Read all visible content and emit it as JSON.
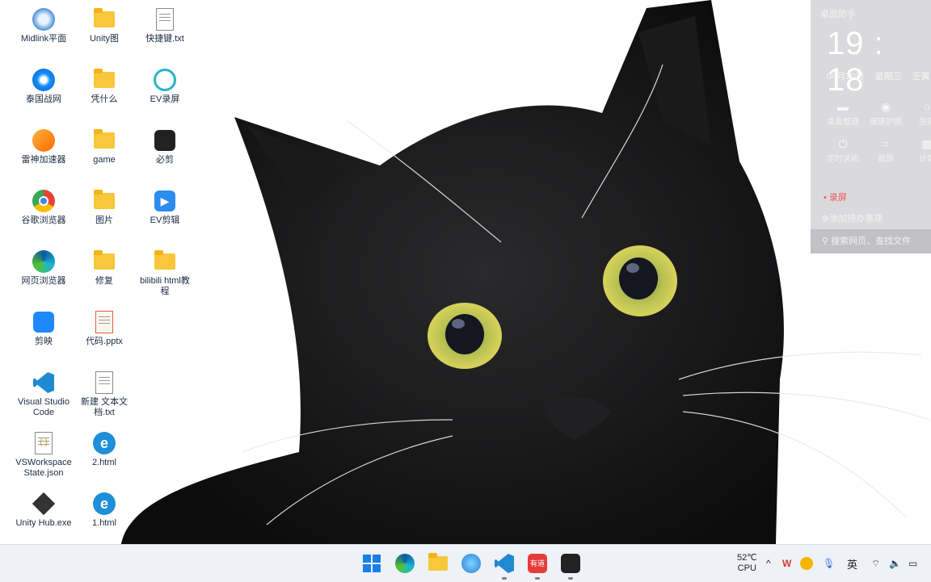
{
  "desktop_icons": [
    {
      "label": "Midlink平面",
      "icon": "midlink-app-icon"
    },
    {
      "label": "Unity图",
      "icon": "folder-icon"
    },
    {
      "label": "快捷键.txt",
      "icon": "text-file-icon"
    },
    {
      "label": "泰国战网",
      "icon": "battle-net-icon"
    },
    {
      "label": "凭什么",
      "icon": "folder-icon"
    },
    {
      "label": "EV录屏",
      "icon": "ev-recorder-icon"
    },
    {
      "label": "雷神加速器",
      "icon": "leishen-accelerator-icon"
    },
    {
      "label": "game",
      "icon": "folder-icon"
    },
    {
      "label": "必剪",
      "icon": "bijian-app-icon"
    },
    {
      "label": "谷歌浏览器",
      "icon": "chrome-icon"
    },
    {
      "label": "图片",
      "icon": "folder-icon"
    },
    {
      "label": "EV剪辑",
      "icon": "ev-editor-icon"
    },
    {
      "label": "网页浏览器",
      "icon": "edge-icon"
    },
    {
      "label": "修复",
      "icon": "folder-icon"
    },
    {
      "label": "bilibili html教程",
      "icon": "folder-icon"
    },
    {
      "label": "剪映",
      "icon": "jianying-icon"
    },
    {
      "label": "代码.pptx",
      "icon": "pptx-file-icon"
    },
    {
      "label": "Visual Studio Code",
      "icon": "vscode-icon"
    },
    {
      "label": "新建 文本文档.txt",
      "icon": "text-file-icon"
    },
    {
      "label": "VSWorkspaceState.json",
      "icon": "json-file-icon"
    },
    {
      "label": "2.html",
      "icon": "ie-html-file-icon"
    },
    {
      "label": "Unity Hub.exe",
      "icon": "unity-hub-icon"
    },
    {
      "label": "1.html",
      "icon": "ie-html-file-icon"
    }
  ],
  "widget": {
    "title": "桌面助手",
    "clock": "19 : 18",
    "date": "04月20日",
    "weekday": "星期三",
    "lunar": "壬寅",
    "tools": [
      "桌面整理",
      "健康护眼",
      "快捷",
      "定时关机",
      "截屏",
      "计算"
    ],
    "record": "录屏",
    "todo": "添加待办事项",
    "search_placeholder": "搜索网页、查找文件"
  },
  "taskbar": {
    "apps": [
      "start-icon",
      "edge-icon",
      "file-explorer-icon",
      "photo-app-icon",
      "vscode-icon",
      "youdao-icon",
      "bijian-app-icon"
    ],
    "youdao_label": "有道",
    "cpu_temp": "52℃",
    "cpu_label": "CPU",
    "ime": "英"
  },
  "colors": {
    "taskbar_bg": "#eef1f6",
    "folder": "#f8c73b",
    "record_red": "#e85b5b"
  }
}
